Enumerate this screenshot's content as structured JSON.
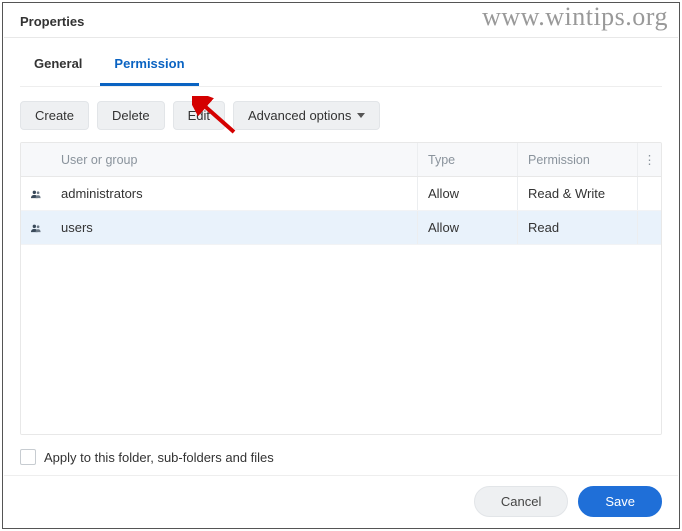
{
  "watermark": "www.wintips.org",
  "title": "Properties",
  "tabs": {
    "general": "General",
    "permission": "Permission"
  },
  "toolbar": {
    "create": "Create",
    "delete": "Delete",
    "edit": "Edit",
    "advanced": "Advanced options"
  },
  "columns": {
    "user": "User or group",
    "type": "Type",
    "permission": "Permission",
    "more": "⋮"
  },
  "rows": [
    {
      "name": "administrators",
      "type": "Allow",
      "permission": "Read & Write",
      "selected": false
    },
    {
      "name": "users",
      "type": "Allow",
      "permission": "Read",
      "selected": true
    }
  ],
  "apply_label": "Apply to this folder, sub-folders and files",
  "actions": {
    "cancel": "Cancel",
    "save": "Save"
  }
}
